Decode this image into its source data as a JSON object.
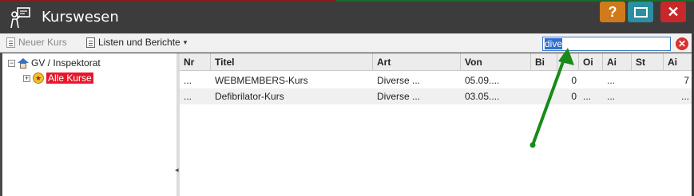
{
  "window": {
    "title": "Kurswesen",
    "help_label": "?",
    "close_label": "✕"
  },
  "toolbar": {
    "new_course_label": "Neuer Kurs",
    "lists_label": "Listen und Berichte",
    "lists_caret": "▾",
    "search_value": "dive",
    "clear_label": "✕"
  },
  "tree": {
    "root": {
      "expander": "−",
      "label": "GV / Inspektorat"
    },
    "child": {
      "expander": "+",
      "label": "Alle Kurse",
      "selected": true
    }
  },
  "grid": {
    "columns": [
      "Nr",
      "Titel",
      "Art",
      "Von",
      "Bi",
      "",
      "Oi",
      "Ai",
      "St",
      "Ai"
    ],
    "rows": [
      [
        "...",
        "WEBMEMBERS-Kurs",
        "Diverse ...",
        "05.09....",
        "",
        "0",
        "",
        "...",
        "",
        "7"
      ],
      [
        "...",
        "Defibrilator-Kurs",
        "Diverse ...",
        "03.05....",
        "",
        "0",
        "...",
        "...",
        "",
        "..."
      ]
    ]
  },
  "colors": {
    "titlebar": "#3c3c3c",
    "help_button": "#d07a1c",
    "maximize_button": "#2a8fa0",
    "close_button": "#c8282a",
    "selection": "#e8182a",
    "annotation_arrow": "#1a8a1a"
  }
}
